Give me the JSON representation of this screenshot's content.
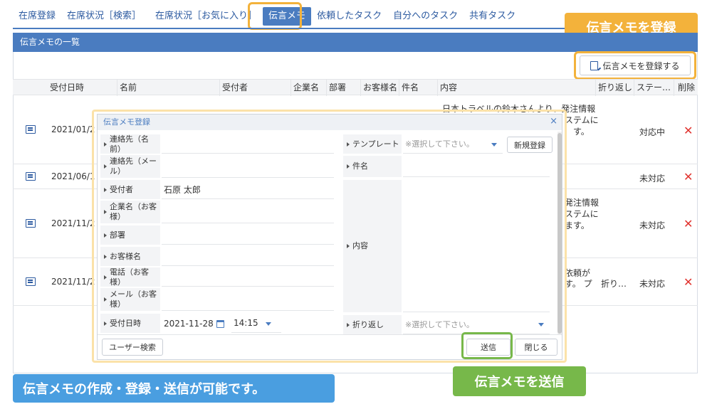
{
  "nav": {
    "tabs": [
      "在席登録",
      "在席状況［検索］",
      "在席状況［お気に入り］",
      "伝言メモ",
      "依頼したタスク",
      "自分へのタスク",
      "共有タスク"
    ],
    "active_tab": "伝言メモ"
  },
  "callouts": {
    "register": "伝言メモを登録",
    "send": "伝言メモを送信",
    "description": "伝言メモの作成・登録・送信が可能です。"
  },
  "section": {
    "title": "伝言メモの一覧"
  },
  "register_button": "伝言メモを登録する",
  "table": {
    "headers": [
      "受付日時",
      "名前",
      "受付者",
      "企業名",
      "部署",
      "お客様名",
      "件名",
      "内容",
      "折り返し",
      "ステー…",
      "削除"
    ],
    "rows": [
      {
        "date": "2021/01/2",
        "content": [
          "日本トラベルの鈴木さんより、発注情報",
          "ステムに",
          "す。"
        ],
        "callback": "",
        "status": "対応中"
      },
      {
        "date": "2021/06/1",
        "content": [],
        "callback": "",
        "status": "未対応"
      },
      {
        "date": "2021/11/2",
        "content": [
          "発注情報",
          "ステムに",
          "ます。"
        ],
        "callback": "",
        "status": "未対応"
      },
      {
        "date": "2021/11/2",
        "content": [
          "依頼が",
          "す。 プ"
        ],
        "callback": "折り…",
        "status": "未対応"
      }
    ]
  },
  "modal": {
    "title": "伝言メモ登録",
    "close_icon": "×",
    "left_fields": [
      {
        "label": "連絡先（名前）",
        "value": ""
      },
      {
        "label": "連絡先（メール）",
        "value": ""
      },
      {
        "label": "受付者",
        "value": "石原 太郎"
      },
      {
        "label": "企業名（お客様）",
        "value": ""
      },
      {
        "label": "部署",
        "value": ""
      },
      {
        "label": "お客様名",
        "value": ""
      },
      {
        "label": "電話（お客様）",
        "value": ""
      },
      {
        "label": "メール（お客様）",
        "value": ""
      },
      {
        "label": "受付日時",
        "date": "2021-11-28",
        "time": "14:15"
      }
    ],
    "template": {
      "label": "テンプレート",
      "placeholder": "※選択して下さい。",
      "new_button": "新規登録"
    },
    "subject_label": "件名",
    "content_label": "内容",
    "callback": {
      "label": "折り返し",
      "placeholder": "※選択して下さい。"
    },
    "user_search_button": "ユーザー検索",
    "send_button": "送信",
    "close_button": "閉じる"
  }
}
